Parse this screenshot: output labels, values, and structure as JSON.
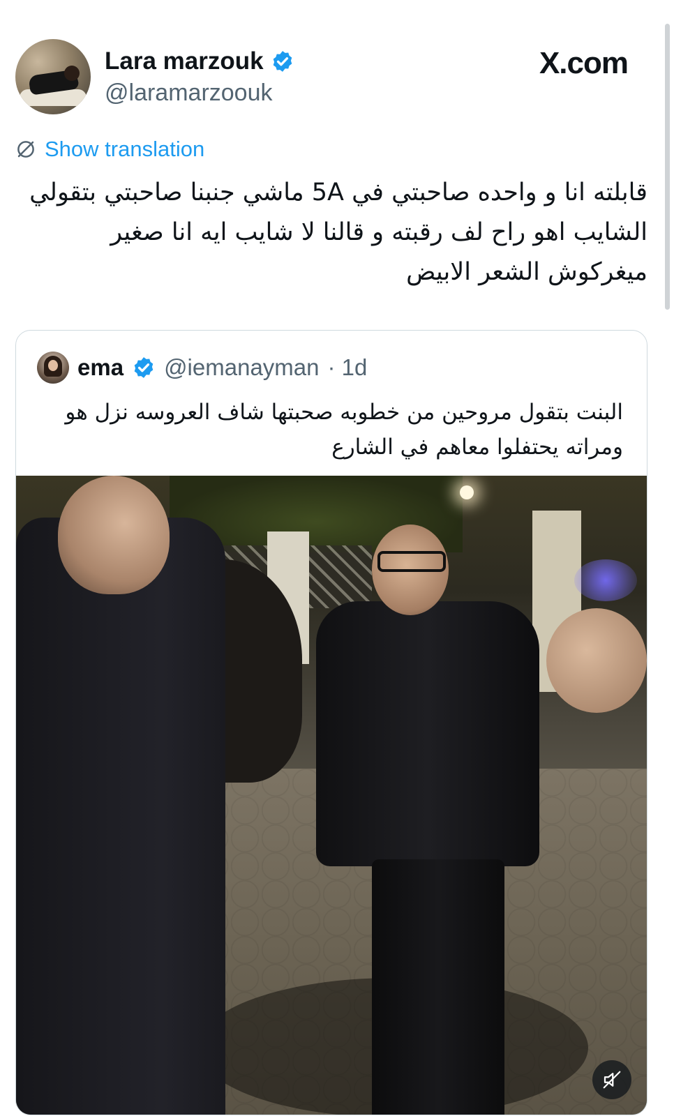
{
  "author": {
    "display_name": "Lara marzouk",
    "handle": "@laramarzoouk",
    "verified": true
  },
  "brand": {
    "site": "X.com"
  },
  "translate": {
    "label": "Show translation",
    "icon": "translate-globe-icon"
  },
  "tweet": {
    "text": "قابلته انا و واحده صاحبتي في 5A ماشي جنبنا صاحبتي بتقولي الشايب اهو راح لف رقبته و قالنا لا شايب ايه انا صغير ميغركوش الشعر الابيض"
  },
  "quoted": {
    "display_name": "ema",
    "handle": "@iemanayman",
    "time": "· 1d",
    "verified": true,
    "text": "البنت بتقول مروحين من خطوبه صحبتها شاف العروسه نزل هو ومراته يحتفلوا معاهم في الشارع",
    "media": {
      "type": "video",
      "mute_icon": "speaker-muted-icon"
    }
  },
  "colors": {
    "link_blue": "#1d9bf0",
    "secondary_text": "#536471",
    "border": "#cfd9de",
    "verified_blue": "#1d9bf0"
  }
}
